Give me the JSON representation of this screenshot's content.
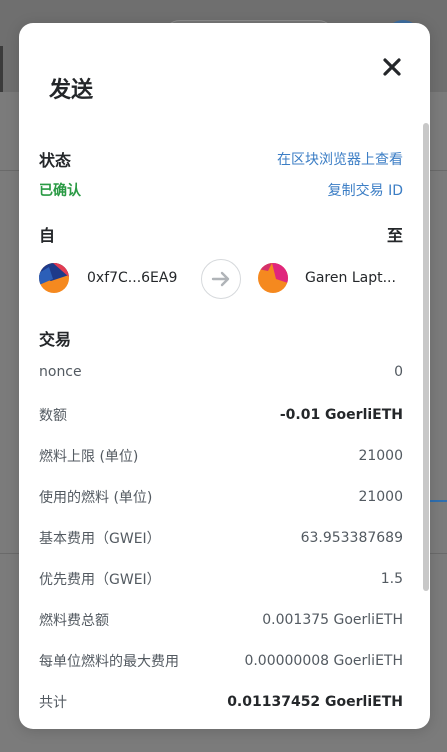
{
  "modal": {
    "title": "发送",
    "status_heading": "状态",
    "view_on_explorer": "在区块浏览器上查看",
    "status_value": "已确认",
    "copy_tx_id": "复制交易 ID",
    "from_label": "自",
    "to_label": "至",
    "from_address": "0xf7C...6EA9",
    "to_name": "Garen Lapt...",
    "transaction_heading": "交易",
    "details": [
      {
        "label": "nonce",
        "value": "0",
        "bold": false
      },
      {
        "label": "数额",
        "value": "-0.01 GoerliETH",
        "bold": true
      },
      {
        "label": "燃料上限 (单位)",
        "value": "21000",
        "bold": false
      },
      {
        "label": "使用的燃料 (单位)",
        "value": "21000",
        "bold": false
      },
      {
        "label": "基本费用（GWEI）",
        "value": "63.953387689",
        "bold": false
      },
      {
        "label": "优先费用（GWEI）",
        "value": "1.5",
        "bold": false
      },
      {
        "label": "燃料费总额",
        "value": "0.001375 GoerliETH",
        "bold": false
      },
      {
        "label": "每单位燃料的最大费用",
        "value": "0.00000008 GoerliETH",
        "bold": false
      },
      {
        "label": "共计",
        "value": "0.01137452 GoerliETH",
        "bold": true
      }
    ]
  },
  "colors": {
    "link": "#3c7ec5",
    "confirmed": "#2a9a44",
    "text_dark": "#24272a",
    "text_muted": "#535a61"
  }
}
